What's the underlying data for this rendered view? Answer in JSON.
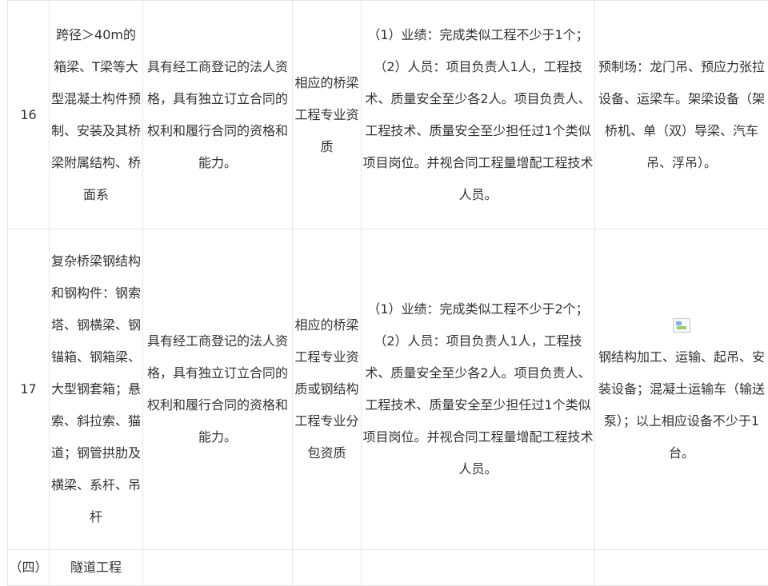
{
  "rows": [
    {
      "no": "16",
      "scope": "跨径＞40m的箱梁、T梁等大型混凝土构件预制、安装及其桥梁附属结构、桥面系",
      "legal": "具有经工商登记的法人资格，具有独立订立合同的权利和履行合同的资格和能力。",
      "qualification": "相应的桥梁工程专业资质",
      "requirement_lines": [
        "（1）业绩：完成类似工程不少于1个；",
        "（2）人员：项目负责人1人，工程技术、质量安全至少各2人。项目负责人、工程技术、质量安全至少担任过1个类似项目岗位。并视合同工程量增配工程技术人员。"
      ],
      "equipment": "预制场：龙门吊、预应力张拉设备、运梁车。架梁设备（架桥机、单（双）导梁、汽车吊、浮吊）。"
    },
    {
      "no": "17",
      "scope": "复杂桥梁钢结构和钢构件：钢索塔、钢横梁、钢锚箱、钢箱梁、大型钢套箱；悬索、斜拉索、猫道；钢管拱肋及横梁、系杆、吊杆",
      "legal": "具有经工商登记的法人资格，具有独立订立合同的权利和履行合同的资格和能力。",
      "qualification": "相应的桥梁工程专业资质或钢结构工程专业分包资质",
      "requirement_lines": [
        "（1）业绩：完成类似工程不少于2个；",
        "（2）人员：项目负责人1人，工程技术、质量安全至少各2人。项目负责人、工程技术、质量安全至少担任过1个类似项目岗位。并视合同工程量增配工程技术人员。"
      ],
      "equipment": "钢结构加工、运输、起吊、安装设备；混凝土运输车（输送泵）；以上相应设备不少于1台。",
      "equipment_icon": "broken-image-icon"
    }
  ],
  "section": {
    "no": "（四）",
    "title": "隧道工程"
  }
}
